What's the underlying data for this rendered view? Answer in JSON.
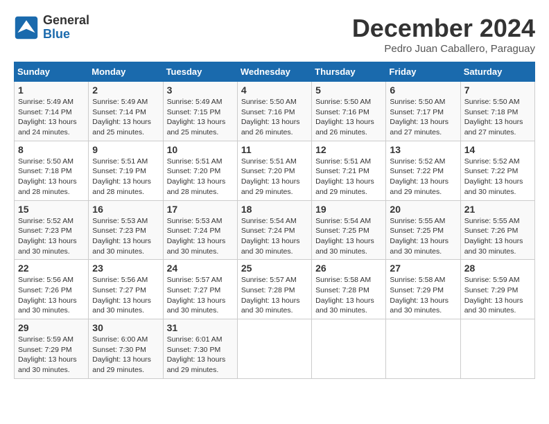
{
  "header": {
    "logo_general": "General",
    "logo_blue": "Blue",
    "month_title": "December 2024",
    "location": "Pedro Juan Caballero, Paraguay"
  },
  "calendar": {
    "days_of_week": [
      "Sunday",
      "Monday",
      "Tuesday",
      "Wednesday",
      "Thursday",
      "Friday",
      "Saturday"
    ],
    "weeks": [
      [
        null,
        {
          "day": 2,
          "sunrise": "5:49 AM",
          "sunset": "7:14 PM",
          "daylight": "13 hours and 25 minutes."
        },
        {
          "day": 3,
          "sunrise": "5:49 AM",
          "sunset": "7:15 PM",
          "daylight": "13 hours and 25 minutes."
        },
        {
          "day": 4,
          "sunrise": "5:50 AM",
          "sunset": "7:16 PM",
          "daylight": "13 hours and 26 minutes."
        },
        {
          "day": 5,
          "sunrise": "5:50 AM",
          "sunset": "7:16 PM",
          "daylight": "13 hours and 26 minutes."
        },
        {
          "day": 6,
          "sunrise": "5:50 AM",
          "sunset": "7:17 PM",
          "daylight": "13 hours and 27 minutes."
        },
        {
          "day": 7,
          "sunrise": "5:50 AM",
          "sunset": "7:18 PM",
          "daylight": "13 hours and 27 minutes."
        }
      ],
      [
        {
          "day": 1,
          "sunrise": "5:49 AM",
          "sunset": "7:14 PM",
          "daylight": "13 hours and 24 minutes."
        },
        null,
        null,
        null,
        null,
        null,
        null
      ],
      [
        {
          "day": 8,
          "sunrise": "5:50 AM",
          "sunset": "7:18 PM",
          "daylight": "13 hours and 28 minutes."
        },
        {
          "day": 9,
          "sunrise": "5:51 AM",
          "sunset": "7:19 PM",
          "daylight": "13 hours and 28 minutes."
        },
        {
          "day": 10,
          "sunrise": "5:51 AM",
          "sunset": "7:20 PM",
          "daylight": "13 hours and 28 minutes."
        },
        {
          "day": 11,
          "sunrise": "5:51 AM",
          "sunset": "7:20 PM",
          "daylight": "13 hours and 29 minutes."
        },
        {
          "day": 12,
          "sunrise": "5:51 AM",
          "sunset": "7:21 PM",
          "daylight": "13 hours and 29 minutes."
        },
        {
          "day": 13,
          "sunrise": "5:52 AM",
          "sunset": "7:22 PM",
          "daylight": "13 hours and 29 minutes."
        },
        {
          "day": 14,
          "sunrise": "5:52 AM",
          "sunset": "7:22 PM",
          "daylight": "13 hours and 30 minutes."
        }
      ],
      [
        {
          "day": 15,
          "sunrise": "5:52 AM",
          "sunset": "7:23 PM",
          "daylight": "13 hours and 30 minutes."
        },
        {
          "day": 16,
          "sunrise": "5:53 AM",
          "sunset": "7:23 PM",
          "daylight": "13 hours and 30 minutes."
        },
        {
          "day": 17,
          "sunrise": "5:53 AM",
          "sunset": "7:24 PM",
          "daylight": "13 hours and 30 minutes."
        },
        {
          "day": 18,
          "sunrise": "5:54 AM",
          "sunset": "7:24 PM",
          "daylight": "13 hours and 30 minutes."
        },
        {
          "day": 19,
          "sunrise": "5:54 AM",
          "sunset": "7:25 PM",
          "daylight": "13 hours and 30 minutes."
        },
        {
          "day": 20,
          "sunrise": "5:55 AM",
          "sunset": "7:25 PM",
          "daylight": "13 hours and 30 minutes."
        },
        {
          "day": 21,
          "sunrise": "5:55 AM",
          "sunset": "7:26 PM",
          "daylight": "13 hours and 30 minutes."
        }
      ],
      [
        {
          "day": 22,
          "sunrise": "5:56 AM",
          "sunset": "7:26 PM",
          "daylight": "13 hours and 30 minutes."
        },
        {
          "day": 23,
          "sunrise": "5:56 AM",
          "sunset": "7:27 PM",
          "daylight": "13 hours and 30 minutes."
        },
        {
          "day": 24,
          "sunrise": "5:57 AM",
          "sunset": "7:27 PM",
          "daylight": "13 hours and 30 minutes."
        },
        {
          "day": 25,
          "sunrise": "5:57 AM",
          "sunset": "7:28 PM",
          "daylight": "13 hours and 30 minutes."
        },
        {
          "day": 26,
          "sunrise": "5:58 AM",
          "sunset": "7:28 PM",
          "daylight": "13 hours and 30 minutes."
        },
        {
          "day": 27,
          "sunrise": "5:58 AM",
          "sunset": "7:29 PM",
          "daylight": "13 hours and 30 minutes."
        },
        {
          "day": 28,
          "sunrise": "5:59 AM",
          "sunset": "7:29 PM",
          "daylight": "13 hours and 30 minutes."
        }
      ],
      [
        {
          "day": 29,
          "sunrise": "5:59 AM",
          "sunset": "7:29 PM",
          "daylight": "13 hours and 30 minutes."
        },
        {
          "day": 30,
          "sunrise": "6:00 AM",
          "sunset": "7:30 PM",
          "daylight": "13 hours and 29 minutes."
        },
        {
          "day": 31,
          "sunrise": "6:01 AM",
          "sunset": "7:30 PM",
          "daylight": "13 hours and 29 minutes."
        },
        null,
        null,
        null,
        null
      ]
    ]
  }
}
